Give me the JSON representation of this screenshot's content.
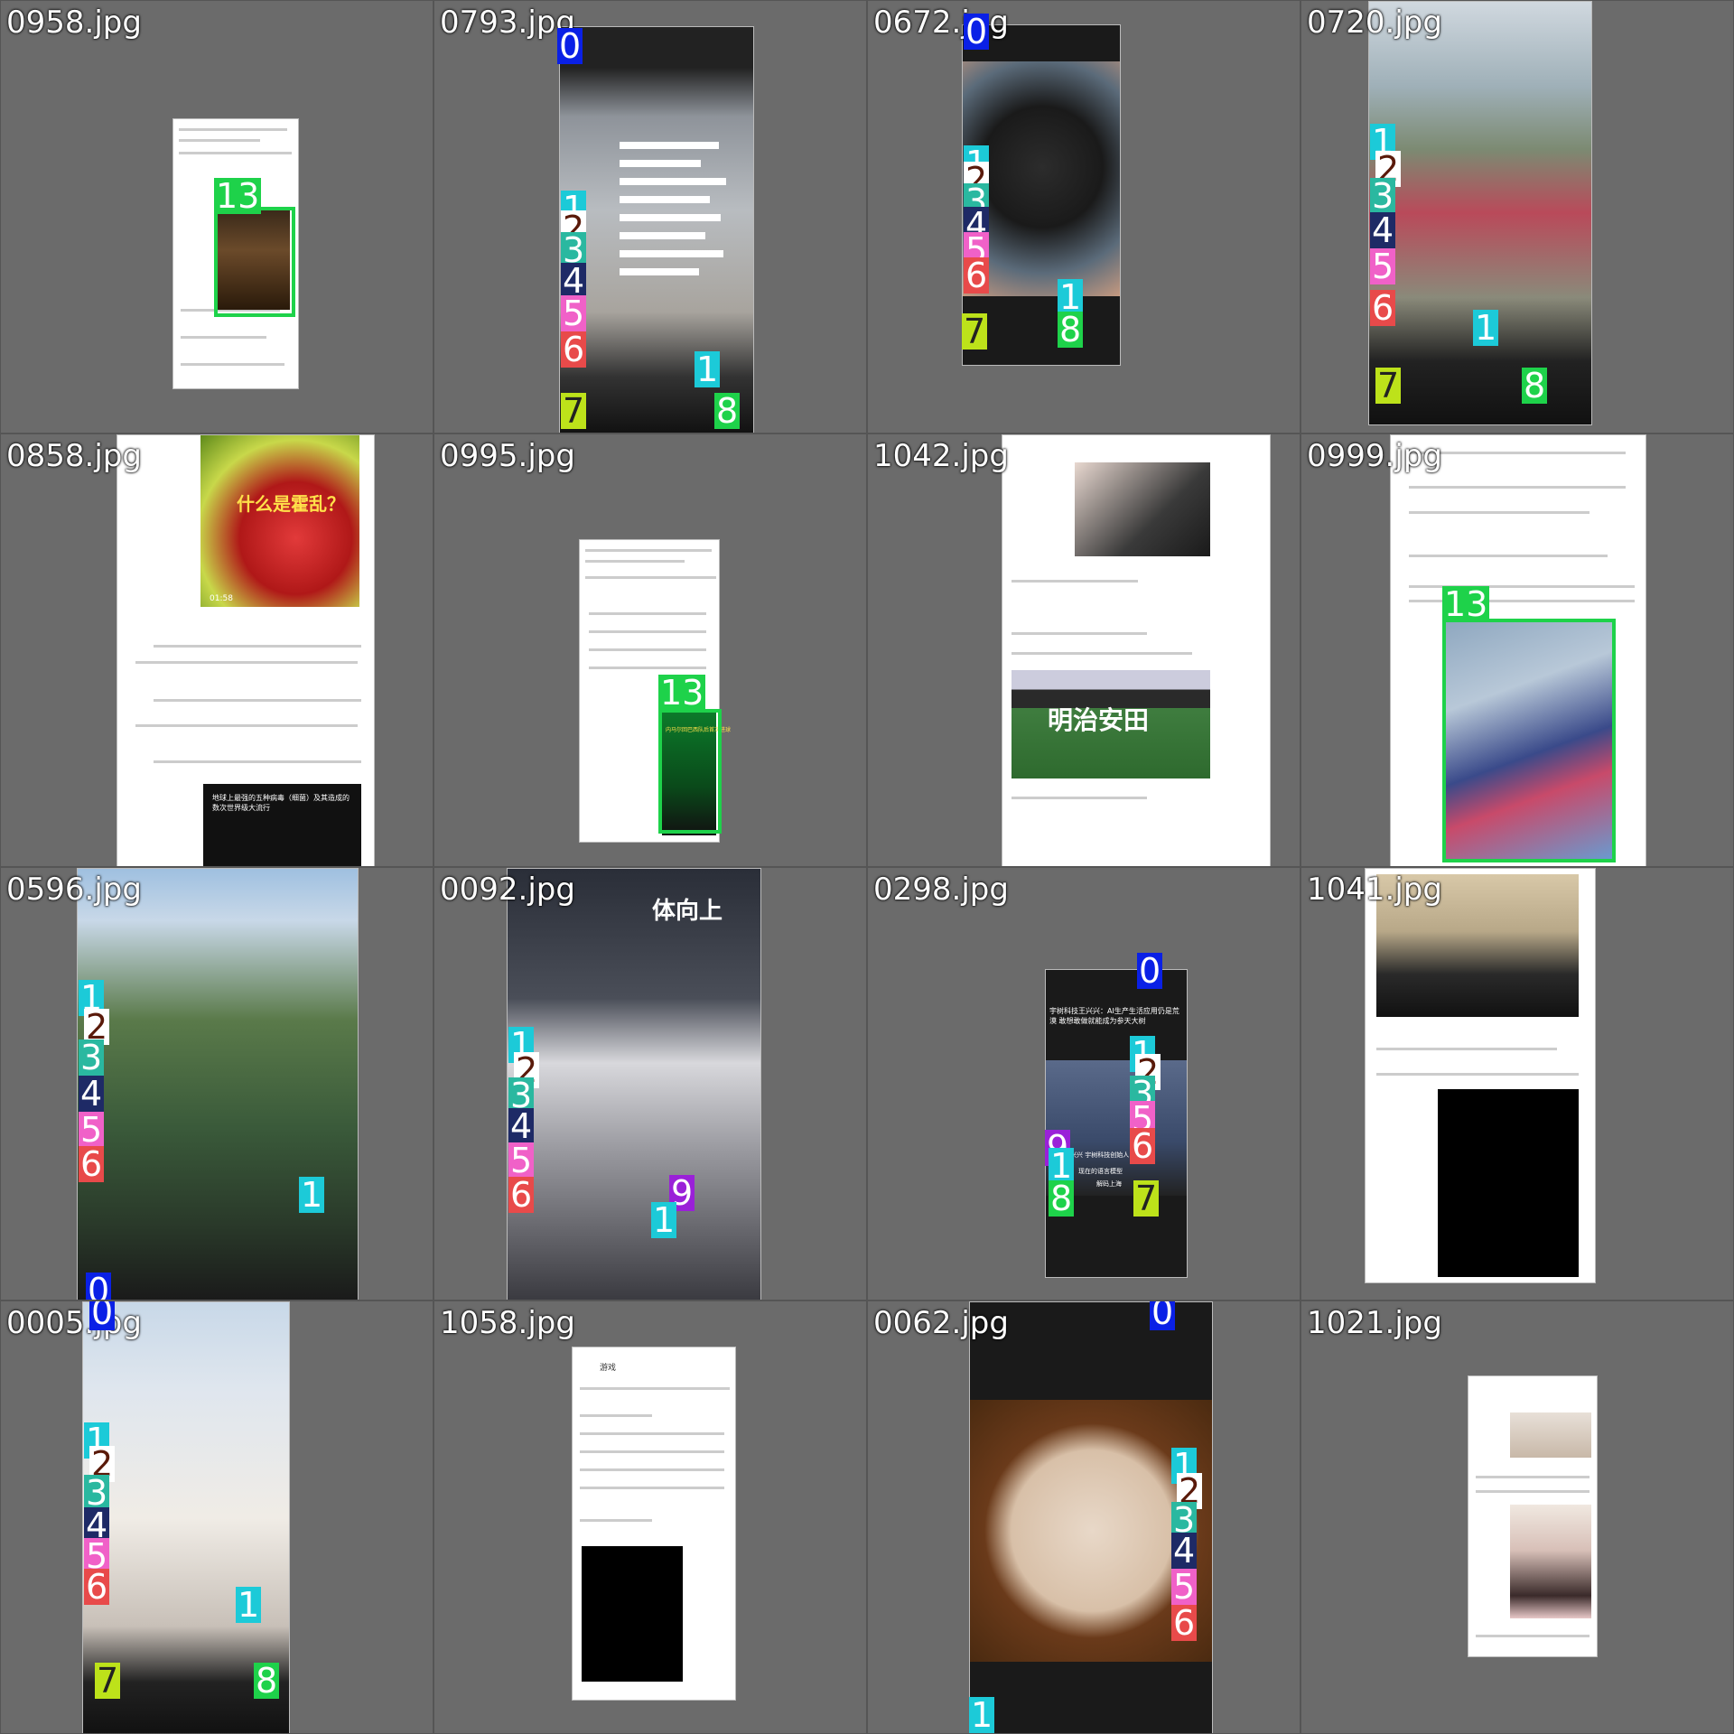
{
  "tiles": [
    {
      "id": "0958",
      "label": "0958.jpg"
    },
    {
      "id": "0793",
      "label": "0793.jpg"
    },
    {
      "id": "0672",
      "label": "0672.jpg"
    },
    {
      "id": "0720",
      "label": "0720.jpg"
    },
    {
      "id": "0858",
      "label": "0858.jpg"
    },
    {
      "id": "0995",
      "label": "0995.jpg"
    },
    {
      "id": "1042",
      "label": "1042.jpg"
    },
    {
      "id": "0999",
      "label": "0999.jpg"
    },
    {
      "id": "0596",
      "label": "0596.jpg"
    },
    {
      "id": "0092",
      "label": "0092.jpg"
    },
    {
      "id": "0298",
      "label": "0298.jpg"
    },
    {
      "id": "1041",
      "label": "1041.jpg"
    },
    {
      "id": "0005",
      "label": "0005.jpg"
    },
    {
      "id": "1058",
      "label": "1058.jpg"
    },
    {
      "id": "0062",
      "label": "0062.jpg"
    },
    {
      "id": "1021",
      "label": "1021.jpg"
    }
  ],
  "badges": {
    "b0": "0",
    "b1": "1",
    "b2": "2",
    "b3": "3",
    "b4": "4",
    "b5": "5",
    "b6": "6",
    "b7": "7",
    "b8": "8",
    "b9": "9",
    "b13": "13"
  },
  "texts": {
    "t0858_overlay": "什么是霍乱？",
    "t0858_time": "01:58",
    "t0858_card": "地球上最强的五种病毒（细菌）及其造成的数次世界级大流行",
    "t1042_sign": "明治安田",
    "t0092_sign": "体向上",
    "t0298_title": "宇树科技王兴兴：AI生产生活应用仍是荒漠 敢想敢做就能成为参天大树",
    "t0298_sub": "王兴兴 宇树科技创始人",
    "t0298_sub2": "现在的语言模型",
    "t0298_logo": "解码上海",
    "t1058_search": "游戏",
    "t0995_video": "内马尔回巴西队后首次进球"
  },
  "colors": {
    "bg": "#777777",
    "badge_blue": "#0a20e6",
    "badge_cyan": "#1ccad8",
    "badge_green": "#1ed24a",
    "badge_pink": "#f061c8",
    "badge_red": "#e84a4a",
    "badge_lime": "#bde21a",
    "badge_purple": "#9a20d8"
  }
}
